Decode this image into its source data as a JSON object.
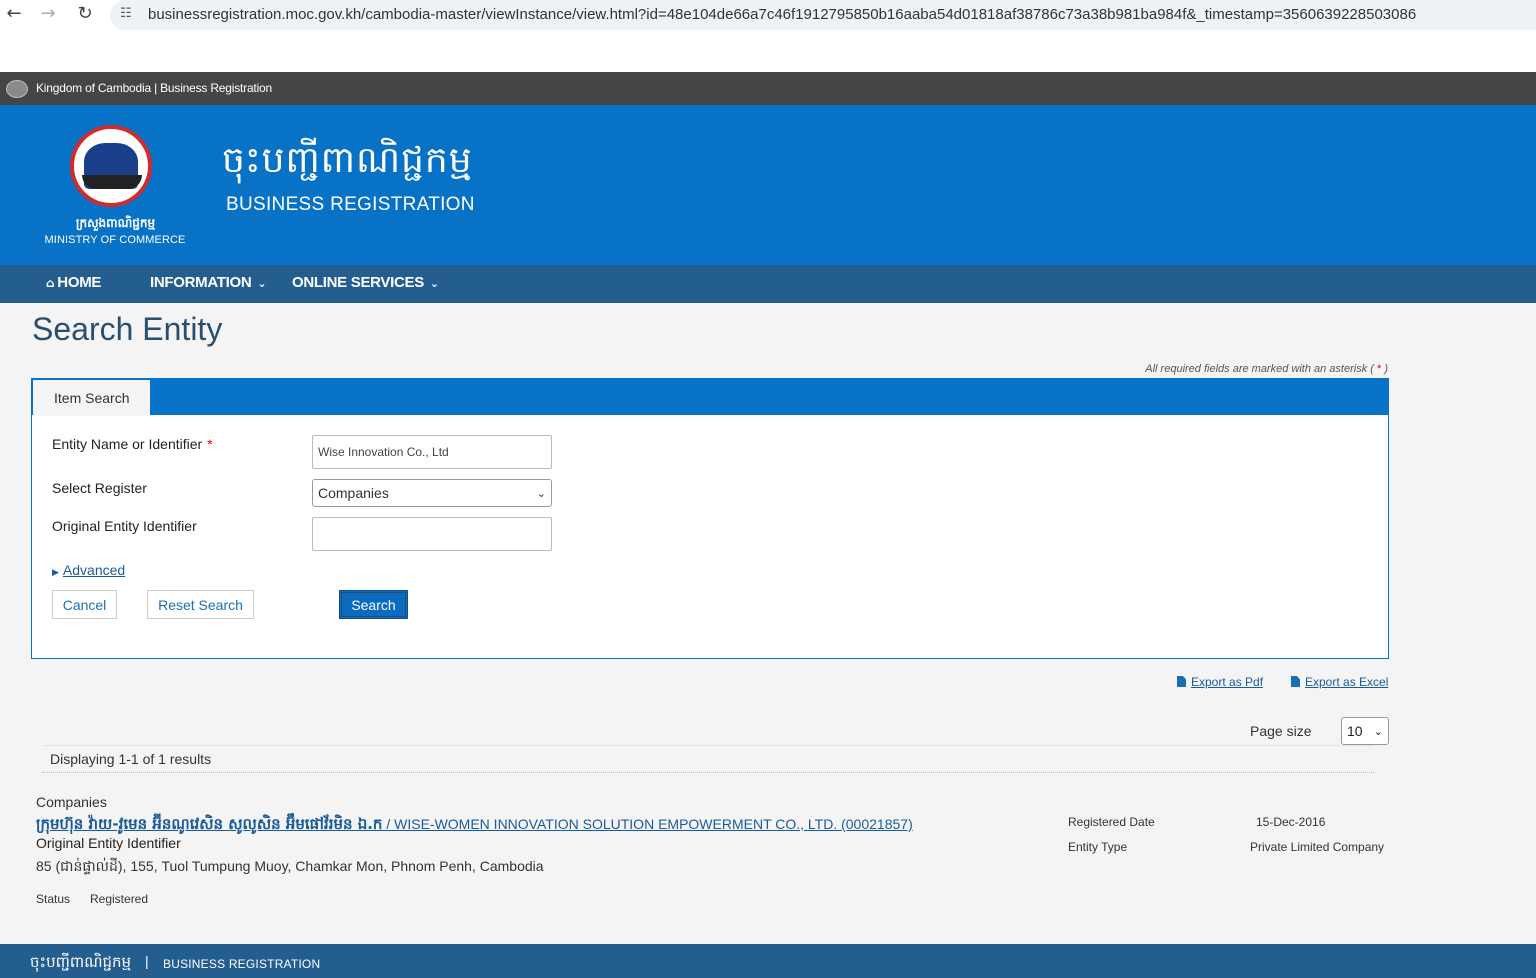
{
  "browser": {
    "back": "←",
    "forward": "→",
    "reload": "↻",
    "url": "businessregistration.moc.gov.kh/cambodia-master/viewInstance/view.html?id=48e104de66a7c46f1912795850b16aaba54d01818af38786c73a38b981ba984f&_timestamp=3560639228503086"
  },
  "gov_bar": {
    "text": "Kingdom of Cambodia | Business Registration"
  },
  "header": {
    "logo_kh": "ក្រសួងពាណិជ្ជកម្ម",
    "logo_en": "MINISTRY OF COMMERCE",
    "title_kh": "ចុះបញ្ជីពាណិជ្ជកម្ម",
    "title_en": "BUSINESS REGISTRATION"
  },
  "nav": {
    "home_icon": "⌂",
    "home": "HOME",
    "information": "INFORMATION",
    "online_services": "ONLINE SERVICES",
    "chevron": "⌄"
  },
  "page": {
    "title": "Search Entity",
    "required_note": "All required fields are marked with an asterisk (",
    "required_star": "*",
    "required_close": ")"
  },
  "form": {
    "tab": "Item Search",
    "entity_name_label": "Entity Name or Identifier",
    "required_star": "*",
    "entity_name_value": "Wise Innovation Co., Ltd",
    "select_register_label": "Select Register",
    "select_register_value": "Companies",
    "original_id_label": "Original Entity Identifier",
    "original_id_value": "",
    "advanced": "Advanced",
    "cancel": "Cancel",
    "reset": "Reset Search",
    "search": "Search"
  },
  "results": {
    "export_pdf": "Export as Pdf",
    "export_excel": "Export as Excel",
    "page_size_label": "Page size",
    "page_size_value": "10",
    "count": "Displaying 1-1 of 1 results",
    "items": [
      {
        "register": "Companies",
        "name_kh": "ក្រុមហ៊ុន វ៉ាយ-វូមេន អ៊ីនណូវេសិន សូលូសិន អ៊ឹមផៅវ័រមិន ឯ.ក",
        "name_en": " / WISE-WOMEN INNOVATION SOLUTION EMPOWERMENT CO., LTD. (00021857)",
        "original_id_label": "Original Entity Identifier",
        "address": "85 (ជាន់ផ្ទាល់ដី), 155, Tuol Tumpung Muoy, Chamkar Mon, Phnom Penh, Cambodia",
        "status_label": "Status",
        "status": "Registered",
        "registered_date_label": "Registered Date",
        "registered_date": "15-Dec-2016",
        "entity_type_label": "Entity Type",
        "entity_type": "Private Limited Company"
      }
    ]
  },
  "footer": {
    "kh": "ចុះបញ្ជីពាណិជ្ជកម្ម",
    "sep": "|",
    "en": "BUSINESS REGISTRATION"
  }
}
